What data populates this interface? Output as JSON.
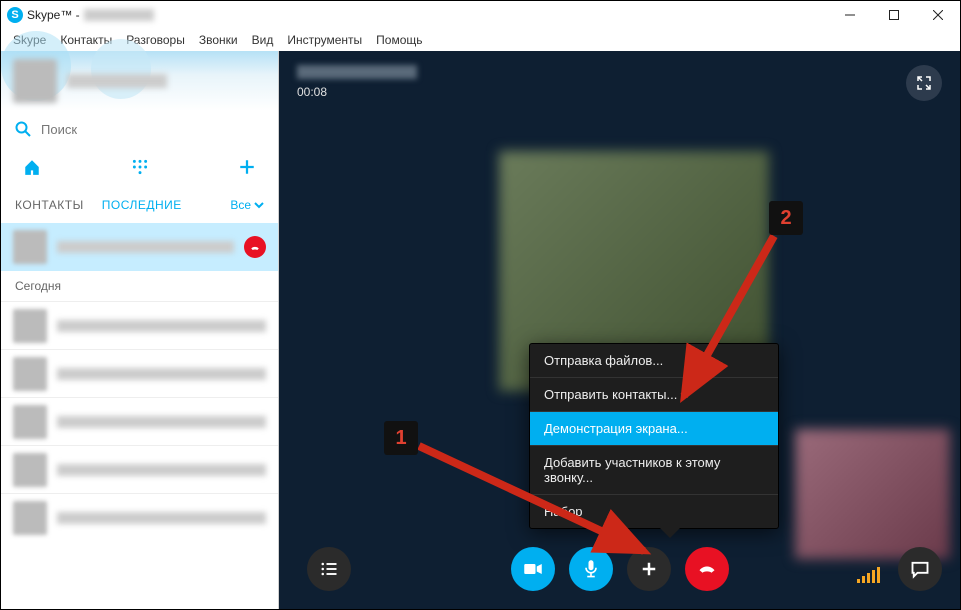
{
  "window": {
    "app_name": "Skype™ - "
  },
  "menu": {
    "skype": "Skype",
    "contacts": "Контакты",
    "conversations": "Разговоры",
    "calls": "Звонки",
    "view": "Вид",
    "tools": "Инструменты",
    "help": "Помощь"
  },
  "sidebar": {
    "search_placeholder": "Поиск",
    "tab_contacts": "КОНТАКТЫ",
    "tab_recent": "ПОСЛЕДНИЕ",
    "filter_all": "Все",
    "section_today": "Сегодня"
  },
  "call": {
    "timer": "00:08"
  },
  "context_menu": {
    "send_files": "Отправка файлов...",
    "send_contacts": "Отправить контакты...",
    "share_screen": "Демонстрация экрана...",
    "add_participants": "Добавить участников к этому звонку...",
    "dial": "Набор"
  },
  "annotations": {
    "marker1": "1",
    "marker2": "2"
  }
}
